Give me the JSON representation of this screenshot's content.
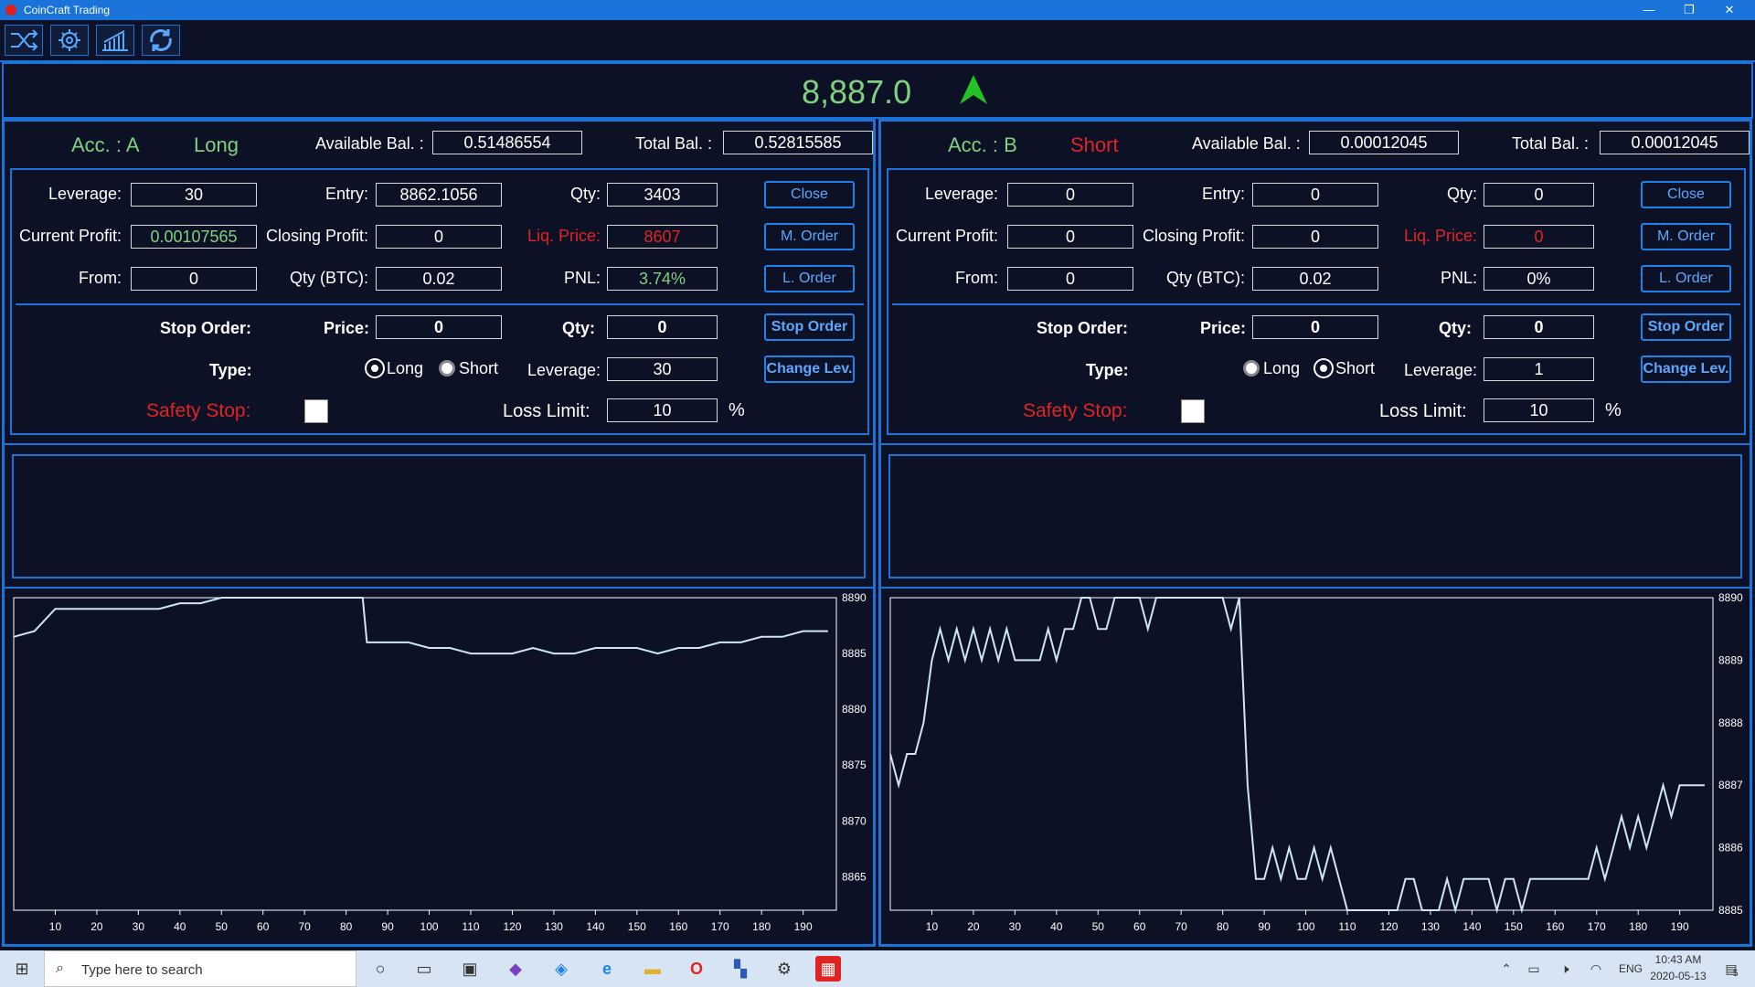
{
  "window": {
    "title": "CoinCraft Trading",
    "min": "—",
    "restore": "❐",
    "close": "✕"
  },
  "ticker": {
    "price": "8,887.0",
    "direction_color": "#22c322"
  },
  "colors": {
    "accent": "#1a73d9",
    "bg": "#0c1126",
    "green": "#7fd17f",
    "red": "#e02424",
    "button": "#5aa9ff"
  },
  "panels": [
    {
      "acc": "Acc. : A",
      "side": "Long",
      "side_color": "#7fd17f",
      "avail_label": "Available Bal. :",
      "avail": "0.51486554",
      "total_label": "Total Bal. :",
      "total": "0.52815585",
      "leverage_label": "Leverage:",
      "leverage": "30",
      "entry_label": "Entry:",
      "entry": "8862.1056",
      "qty_label": "Qty:",
      "qty": "3403",
      "profit_label": "Current Profit:",
      "profit": "0.00107565",
      "closing_label": "Closing Profit:",
      "closing": "0",
      "liq_label": "Liq. Price:",
      "liq": "8607",
      "from_label": "From:",
      "from": "0",
      "qtybtc_label": "Qty (BTC):",
      "qtybtc": "0.02",
      "pnl_label": "PNL:",
      "pnl": "3.74%",
      "close_btn": "Close",
      "morder_btn": "M. Order",
      "lorder_btn": "L. Order",
      "stop_label": "Stop Order:",
      "price_label": "Price:",
      "stop_price": "0",
      "stop_qty_label": "Qty:",
      "stop_qty": "0",
      "stop_btn": "Stop Order",
      "type_label": "Type:",
      "long_label": "Long",
      "short_label": "Short",
      "type_selected": "Long",
      "lev2_label": "Leverage:",
      "lev2": "30",
      "change_btn": "Change Lev.",
      "safety_label": "Safety Stop:",
      "loss_label": "Loss Limit:",
      "loss": "10",
      "pct": "%"
    },
    {
      "acc": "Acc. : B",
      "side": "Short",
      "side_color": "#e02424",
      "avail_label": "Available Bal. :",
      "avail": "0.00012045",
      "total_label": "Total Bal. :",
      "total": "0.00012045",
      "leverage_label": "Leverage:",
      "leverage": "0",
      "entry_label": "Entry:",
      "entry": "0",
      "qty_label": "Qty:",
      "qty": "0",
      "profit_label": "Current Profit:",
      "profit": "0",
      "closing_label": "Closing Profit:",
      "closing": "0",
      "liq_label": "Liq. Price:",
      "liq": "0",
      "from_label": "From:",
      "from": "0",
      "qtybtc_label": "Qty (BTC):",
      "qtybtc": "0.02",
      "pnl_label": "PNL:",
      "pnl": "0%",
      "close_btn": "Close",
      "morder_btn": "M. Order",
      "lorder_btn": "L. Order",
      "stop_label": "Stop Order:",
      "price_label": "Price:",
      "stop_price": "0",
      "stop_qty_label": "Qty:",
      "stop_qty": "0",
      "stop_btn": "Stop Order",
      "type_label": "Type:",
      "long_label": "Long",
      "short_label": "Short",
      "type_selected": "Short",
      "lev2_label": "Leverage:",
      "lev2": "1",
      "change_btn": "Change Lev.",
      "safety_label": "Safety Stop:",
      "loss_label": "Loss Limit:",
      "loss": "10",
      "pct": "%"
    }
  ],
  "chart_data": [
    {
      "type": "line",
      "x": [
        0,
        5,
        10,
        15,
        20,
        25,
        30,
        35,
        40,
        45,
        50,
        55,
        60,
        65,
        70,
        75,
        80,
        84,
        85,
        90,
        95,
        100,
        105,
        110,
        115,
        120,
        125,
        130,
        135,
        140,
        145,
        150,
        155,
        160,
        165,
        170,
        175,
        180,
        185,
        190,
        196
      ],
      "y": [
        8886.5,
        8887,
        8889,
        8889,
        8889,
        8889,
        8889,
        8889,
        8889.5,
        8889.5,
        8890,
        8890,
        8890,
        8890,
        8890,
        8890,
        8890,
        8890,
        8886,
        8886,
        8886,
        8885.5,
        8885.5,
        8885,
        8885,
        8885,
        8885.5,
        8885,
        8885,
        8885.5,
        8885.5,
        8885.5,
        8885,
        8885.5,
        8885.5,
        8886,
        8886,
        8886.5,
        8886.5,
        8887,
        8887
      ],
      "xticks": [
        10,
        20,
        30,
        40,
        50,
        60,
        70,
        80,
        90,
        100,
        110,
        120,
        130,
        140,
        150,
        160,
        170,
        180,
        190
      ],
      "yticks": [
        8865,
        8870,
        8875,
        8880,
        8885,
        8890
      ],
      "ylim": [
        8862,
        8890
      ]
    },
    {
      "type": "line",
      "x": [
        0,
        2,
        4,
        6,
        8,
        10,
        12,
        14,
        16,
        18,
        20,
        22,
        24,
        26,
        28,
        30,
        32,
        34,
        36,
        38,
        40,
        42,
        44,
        46,
        48,
        50,
        52,
        54,
        56,
        58,
        60,
        62,
        64,
        66,
        68,
        70,
        72,
        74,
        76,
        78,
        80,
        82,
        84,
        86,
        88,
        90,
        92,
        94,
        96,
        98,
        100,
        102,
        104,
        106,
        108,
        110,
        115,
        120,
        122,
        124,
        126,
        128,
        130,
        132,
        134,
        136,
        138,
        140,
        142,
        144,
        146,
        148,
        150,
        152,
        154,
        156,
        158,
        160,
        162,
        164,
        166,
        168,
        170,
        172,
        174,
        176,
        178,
        180,
        182,
        184,
        186,
        188,
        190,
        192,
        196
      ],
      "y": [
        8887.5,
        8887,
        8887.5,
        8887.5,
        8888,
        8889,
        8889.5,
        8889,
        8889.5,
        8889,
        8889.5,
        8889,
        8889.5,
        8889,
        8889.5,
        8889,
        8889,
        8889,
        8889,
        8889.5,
        8889,
        8889.5,
        8889.5,
        8890,
        8890,
        8889.5,
        8889.5,
        8890,
        8890,
        8890,
        8890,
        8889.5,
        8890,
        8890,
        8890,
        8890,
        8890,
        8890,
        8890,
        8890,
        8890,
        8889.5,
        8890,
        8887,
        8885.5,
        8885.5,
        8886,
        8885.5,
        8886,
        8885.5,
        8885.5,
        8886,
        8885.5,
        8886,
        8885.5,
        8885,
        8885,
        8885,
        8885,
        8885.5,
        8885.5,
        8885,
        8885,
        8885,
        8885.5,
        8885,
        8885.5,
        8885.5,
        8885.5,
        8885.5,
        8885,
        8885.5,
        8885.5,
        8885,
        8885.5,
        8885.5,
        8885.5,
        8885.5,
        8885.5,
        8885.5,
        8885.5,
        8885.5,
        8886,
        8885.5,
        8886,
        8886.5,
        8886,
        8886.5,
        8886,
        8886.5,
        8887,
        8886.5,
        8887,
        8887,
        8887
      ],
      "xticks": [
        10,
        20,
        30,
        40,
        50,
        60,
        70,
        80,
        90,
        100,
        110,
        120,
        130,
        140,
        150,
        160,
        170,
        180,
        190
      ],
      "yticks": [
        8885,
        8886,
        8887,
        8888,
        8889,
        8890
      ],
      "ylim": [
        8885,
        8890
      ]
    }
  ],
  "taskbar": {
    "search_placeholder": "Type here to search",
    "time": "10:43 AM",
    "date": "2020-05-13",
    "lang": "ENG",
    "notif": "5"
  }
}
